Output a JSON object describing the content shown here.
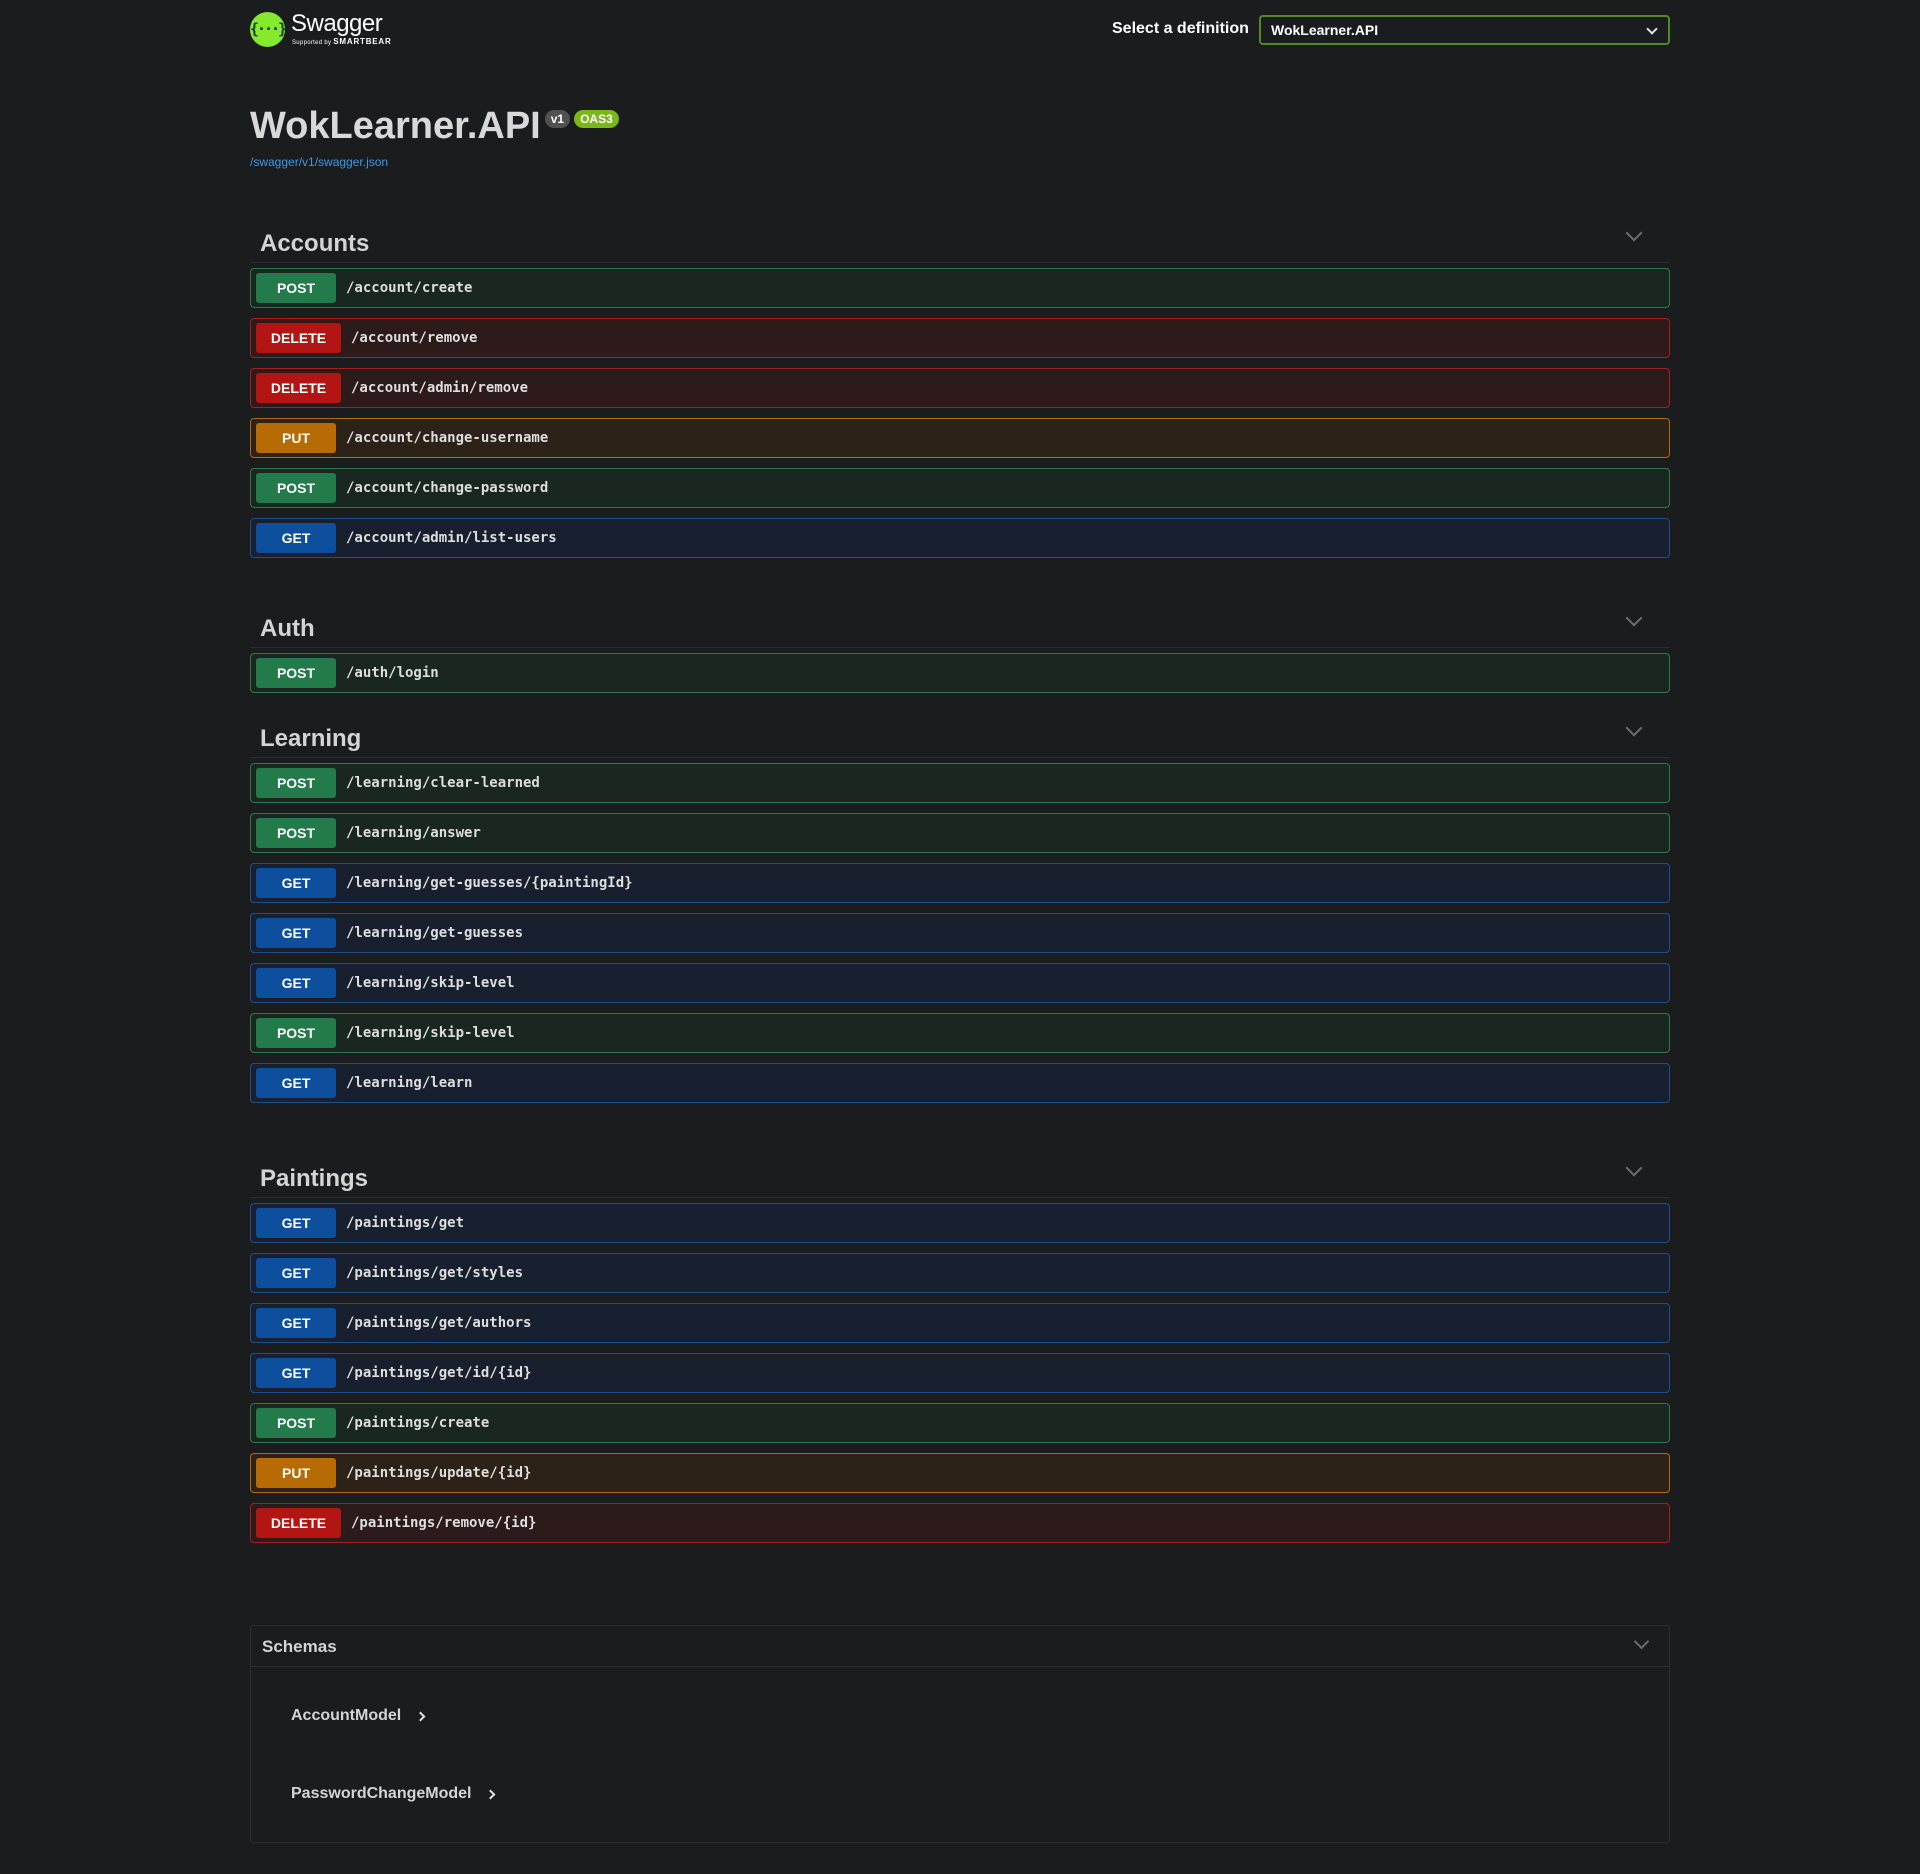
{
  "topbar": {
    "logo_name": "Swagger",
    "logo_sub_prefix": "Supported by",
    "logo_sub_brand": "SMARTBEAR",
    "definition_label": "Select a definition",
    "definition_value": "WokLearner.API"
  },
  "info": {
    "title": "WokLearner.API",
    "version": "v1",
    "oas": "OAS3",
    "url": "/swagger/v1/swagger.json"
  },
  "colors": {
    "post": "#237a4b",
    "get": "#0d4f9c",
    "put": "#b66b05",
    "delete": "#b31414",
    "accent": "#85ea2d"
  },
  "sections": [
    {
      "title": "Accounts",
      "ops": [
        {
          "method": "POST",
          "path": "/account/create"
        },
        {
          "method": "DELETE",
          "path": "/account/remove"
        },
        {
          "method": "DELETE",
          "path": "/account/admin/remove"
        },
        {
          "method": "PUT",
          "path": "/account/change-username"
        },
        {
          "method": "POST",
          "path": "/account/change-password"
        },
        {
          "method": "GET",
          "path": "/account/admin/list-users"
        }
      ]
    },
    {
      "title": "Auth",
      "ops": [
        {
          "method": "POST",
          "path": "/auth/login"
        }
      ]
    },
    {
      "title": "Learning",
      "ops": [
        {
          "method": "POST",
          "path": "/learning/clear-learned"
        },
        {
          "method": "POST",
          "path": "/learning/answer"
        },
        {
          "method": "GET",
          "path": "/learning/get-guesses/{paintingId}"
        },
        {
          "method": "GET",
          "path": "/learning/get-guesses"
        },
        {
          "method": "GET",
          "path": "/learning/skip-level"
        },
        {
          "method": "POST",
          "path": "/learning/skip-level"
        },
        {
          "method": "GET",
          "path": "/learning/learn"
        }
      ]
    },
    {
      "title": "Paintings",
      "ops": [
        {
          "method": "GET",
          "path": "/paintings/get"
        },
        {
          "method": "GET",
          "path": "/paintings/get/styles"
        },
        {
          "method": "GET",
          "path": "/paintings/get/authors"
        },
        {
          "method": "GET",
          "path": "/paintings/get/id/{id}"
        },
        {
          "method": "POST",
          "path": "/paintings/create"
        },
        {
          "method": "PUT",
          "path": "/paintings/update/{id}"
        },
        {
          "method": "DELETE",
          "path": "/paintings/remove/{id}"
        }
      ]
    }
  ],
  "schemas": {
    "title": "Schemas",
    "models": [
      "AccountModel",
      "PasswordChangeModel"
    ]
  }
}
